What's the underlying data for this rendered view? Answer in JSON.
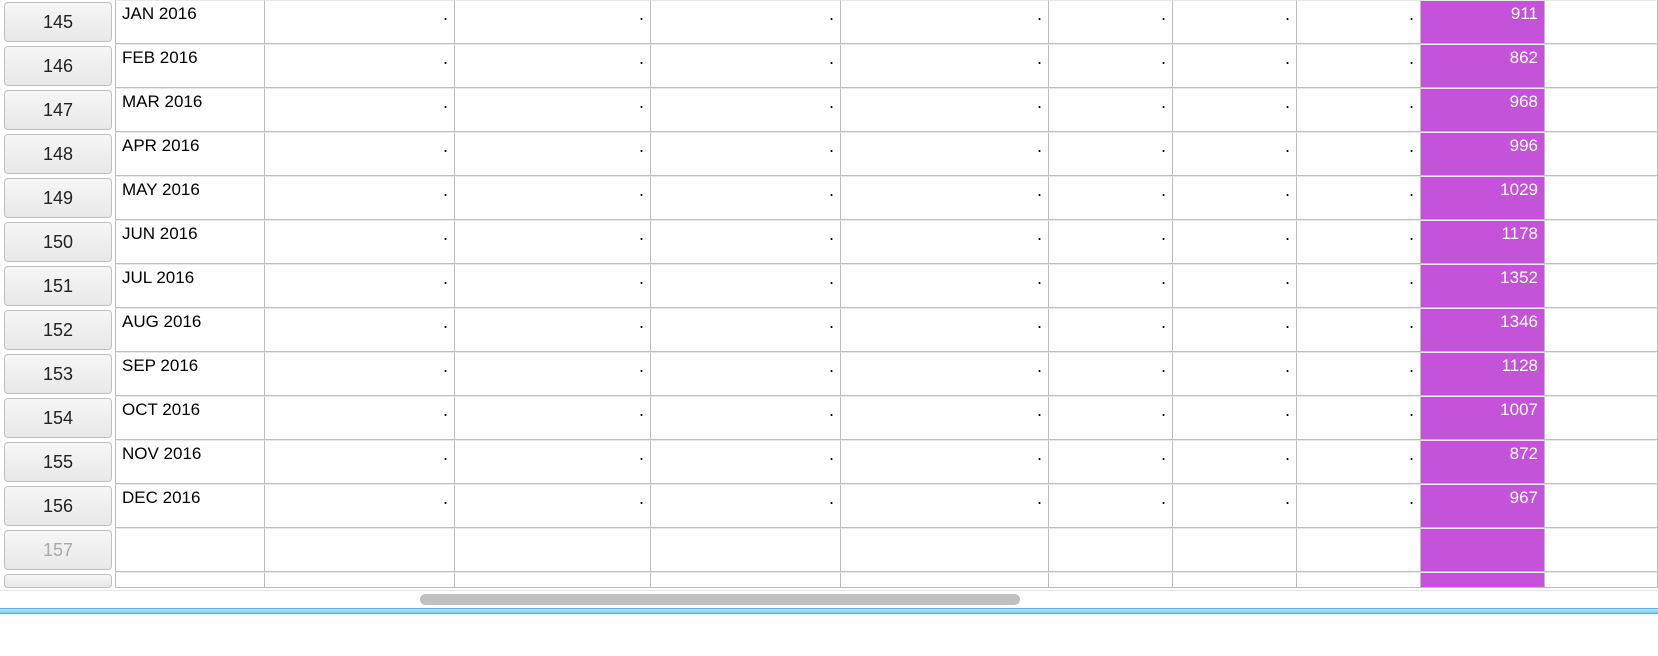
{
  "colors": {
    "highlight": "#c553d9"
  },
  "dot": ".",
  "rows": [
    {
      "n": "145",
      "date": "JAN 2016",
      "pred": "911"
    },
    {
      "n": "146",
      "date": "FEB 2016",
      "pred": "862"
    },
    {
      "n": "147",
      "date": "MAR 2016",
      "pred": "968"
    },
    {
      "n": "148",
      "date": "APR 2016",
      "pred": "996"
    },
    {
      "n": "149",
      "date": "MAY 2016",
      "pred": "1029"
    },
    {
      "n": "150",
      "date": "JUN 2016",
      "pred": "1178"
    },
    {
      "n": "151",
      "date": "JUL 2016",
      "pred": "1352"
    },
    {
      "n": "152",
      "date": "AUG 2016",
      "pred": "1346"
    },
    {
      "n": "153",
      "date": "SEP 2016",
      "pred": "1128"
    },
    {
      "n": "154",
      "date": "OCT 2016",
      "pred": "1007"
    },
    {
      "n": "155",
      "date": "NOV 2016",
      "pred": "872"
    },
    {
      "n": "156",
      "date": "DEC 2016",
      "pred": "967"
    },
    {
      "n": "157",
      "date": "",
      "pred": ""
    }
  ]
}
